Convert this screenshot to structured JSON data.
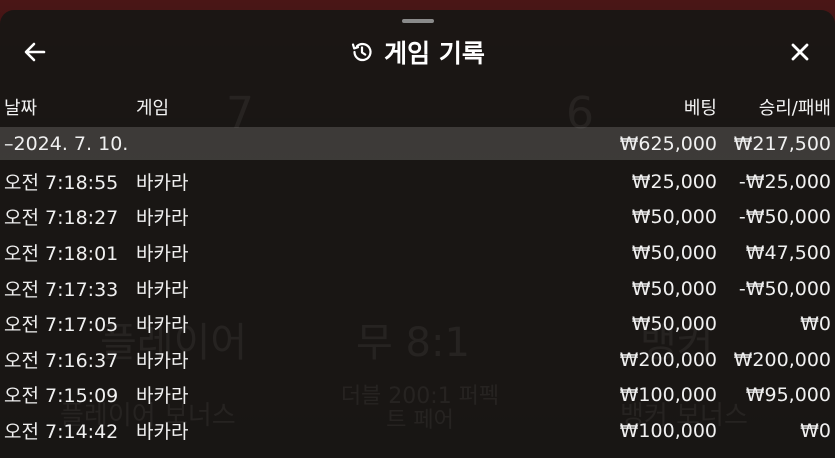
{
  "header": {
    "title": "게임 기록",
    "back_icon": "arrow-left-icon",
    "history_icon": "history-icon",
    "close_icon": "close-icon"
  },
  "columns": {
    "date": "날짜",
    "game": "게임",
    "bet": "베팅",
    "win_loss": "승리/패배"
  },
  "group": {
    "date": "–2024. 7. 10.",
    "bet": "₩625,000",
    "win_loss": "₩217,500"
  },
  "rows": [
    {
      "time": "오전 7:18:55",
      "game": "바카라",
      "bet": "₩25,000",
      "win_loss": "-₩25,000"
    },
    {
      "time": "오전 7:18:27",
      "game": "바카라",
      "bet": "₩50,000",
      "win_loss": "-₩50,000"
    },
    {
      "time": "오전 7:18:01",
      "game": "바카라",
      "bet": "₩50,000",
      "win_loss": "₩47,500"
    },
    {
      "time": "오전 7:17:33",
      "game": "바카라",
      "bet": "₩50,000",
      "win_loss": "-₩50,000"
    },
    {
      "time": "오전 7:17:05",
      "game": "바카라",
      "bet": "₩50,000",
      "win_loss": "₩0"
    },
    {
      "time": "오전 7:16:37",
      "game": "바카라",
      "bet": "₩200,000",
      "win_loss": "₩200,000"
    },
    {
      "time": "오전 7:15:09",
      "game": "바카라",
      "bet": "₩100,000",
      "win_loss": "₩95,000"
    },
    {
      "time": "오전 7:14:42",
      "game": "바카라",
      "bet": "₩100,000",
      "win_loss": "₩0"
    }
  ],
  "background": {
    "left_label": "플레이어",
    "center_label": "무 8:1",
    "right_label": "뱅커",
    "left_bonus": "플레이어 보너스",
    "center_bonus": "더블 200:1 퍼펙트 페어",
    "right_bonus": "뱅커 보너스",
    "left_score": "7",
    "right_score": "6"
  },
  "colors": {
    "panel": "#181614",
    "group_row": "#4a4847",
    "text": "#f0f0f0"
  }
}
